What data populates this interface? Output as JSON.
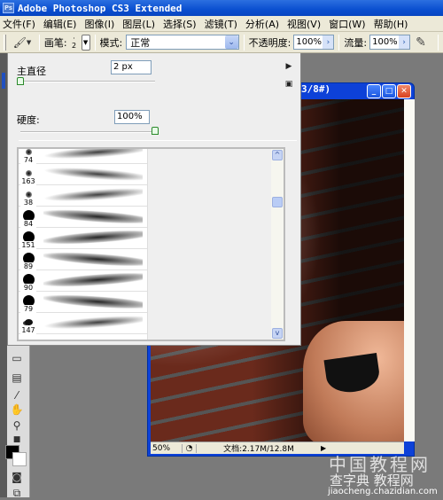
{
  "app": {
    "title": "Adobe Photoshop CS3 Extended",
    "icon": "Ps"
  },
  "menu": [
    "文件(F)",
    "编辑(E)",
    "图像(I)",
    "图层(L)",
    "选择(S)",
    "滤镜(T)",
    "分析(A)",
    "视图(V)",
    "窗口(W)",
    "帮助(H)"
  ],
  "options": {
    "brush_label": "画笔:",
    "brush_size": "2",
    "mode_label": "模式:",
    "mode_value": "正常",
    "opacity_label": "不透明度:",
    "opacity_value": "100%",
    "flow_label": "流量:",
    "flow_value": "100%"
  },
  "brush_panel": {
    "diameter_label": "主直径",
    "diameter_value": "2 px",
    "diameter_slider": 0.0,
    "hardness_label": "硬度:",
    "hardness_value": "100%",
    "hardness_slider": 1.0,
    "presets": [
      {
        "size": "74",
        "tip": "soft-small"
      },
      {
        "size": "163",
        "tip": "soft-small"
      },
      {
        "size": "38",
        "tip": "soft-small"
      },
      {
        "size": "84",
        "tip": "hard-round"
      },
      {
        "size": "151",
        "tip": "hard-round"
      },
      {
        "size": "89",
        "tip": "hard-round"
      },
      {
        "size": "90",
        "tip": "hard-round"
      },
      {
        "size": "79",
        "tip": "hard-round"
      },
      {
        "size": "147",
        "tip": "splatter"
      }
    ]
  },
  "document": {
    "title": "3/8#)",
    "zoom": "50%",
    "doc_info": "文档:2.17M/12.8M"
  },
  "watermark": {
    "line1": "中国教程网",
    "line2": "查字典 教程网",
    "url": "jiaocheng.chazidian.com"
  }
}
